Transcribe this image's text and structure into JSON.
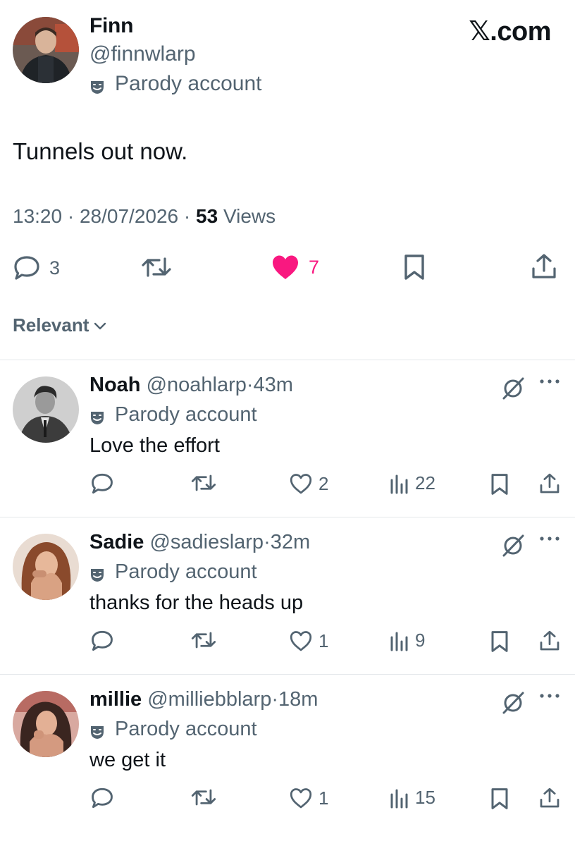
{
  "brand": "𝕏.com",
  "post": {
    "author_name": "Finn",
    "author_handle": "@finnwlarp",
    "parody_label": "Parody account",
    "text": "Tunnels out now.",
    "time": "13:20",
    "date": "28/07/2026",
    "separator": "·",
    "views_count": "53",
    "views_label": "Views",
    "actions": {
      "reply_count": "3",
      "like_count": "7",
      "like_color": "#f91880"
    }
  },
  "sort": {
    "label": "Relevant"
  },
  "replies": [
    {
      "name": "Noah",
      "handle": "@noahlarp",
      "separator": "·",
      "time": "43m",
      "parody_label": "Parody account",
      "text": "Love the effort",
      "like_count": "2",
      "view_count": "22"
    },
    {
      "name": "Sadie",
      "handle": "@sadieslarp",
      "separator": "·",
      "time": "32m",
      "parody_label": "Parody account",
      "text": "thanks for the heads up",
      "like_count": "1",
      "view_count": "9"
    },
    {
      "name": "millie",
      "handle": "@milliebblarp",
      "separator": "·",
      "time": "18m",
      "parody_label": "Parody account",
      "text": "we get it",
      "like_count": "1",
      "view_count": "15"
    }
  ],
  "icons": {
    "reply": "speech-bubble-icon",
    "repost": "repost-arrows-icon",
    "like": "heart-icon",
    "bookmark": "bookmark-icon",
    "share": "share-upload-icon",
    "views": "bar-chart-icon",
    "grok": "grok-icon",
    "more": "more-dots-icon",
    "parody": "theater-mask-icon",
    "sort": "chevron-down-icon"
  },
  "colors": {
    "text": "#0f1419",
    "secondary": "#536471",
    "like": "#f91880",
    "divider": "#e4e7ea"
  }
}
